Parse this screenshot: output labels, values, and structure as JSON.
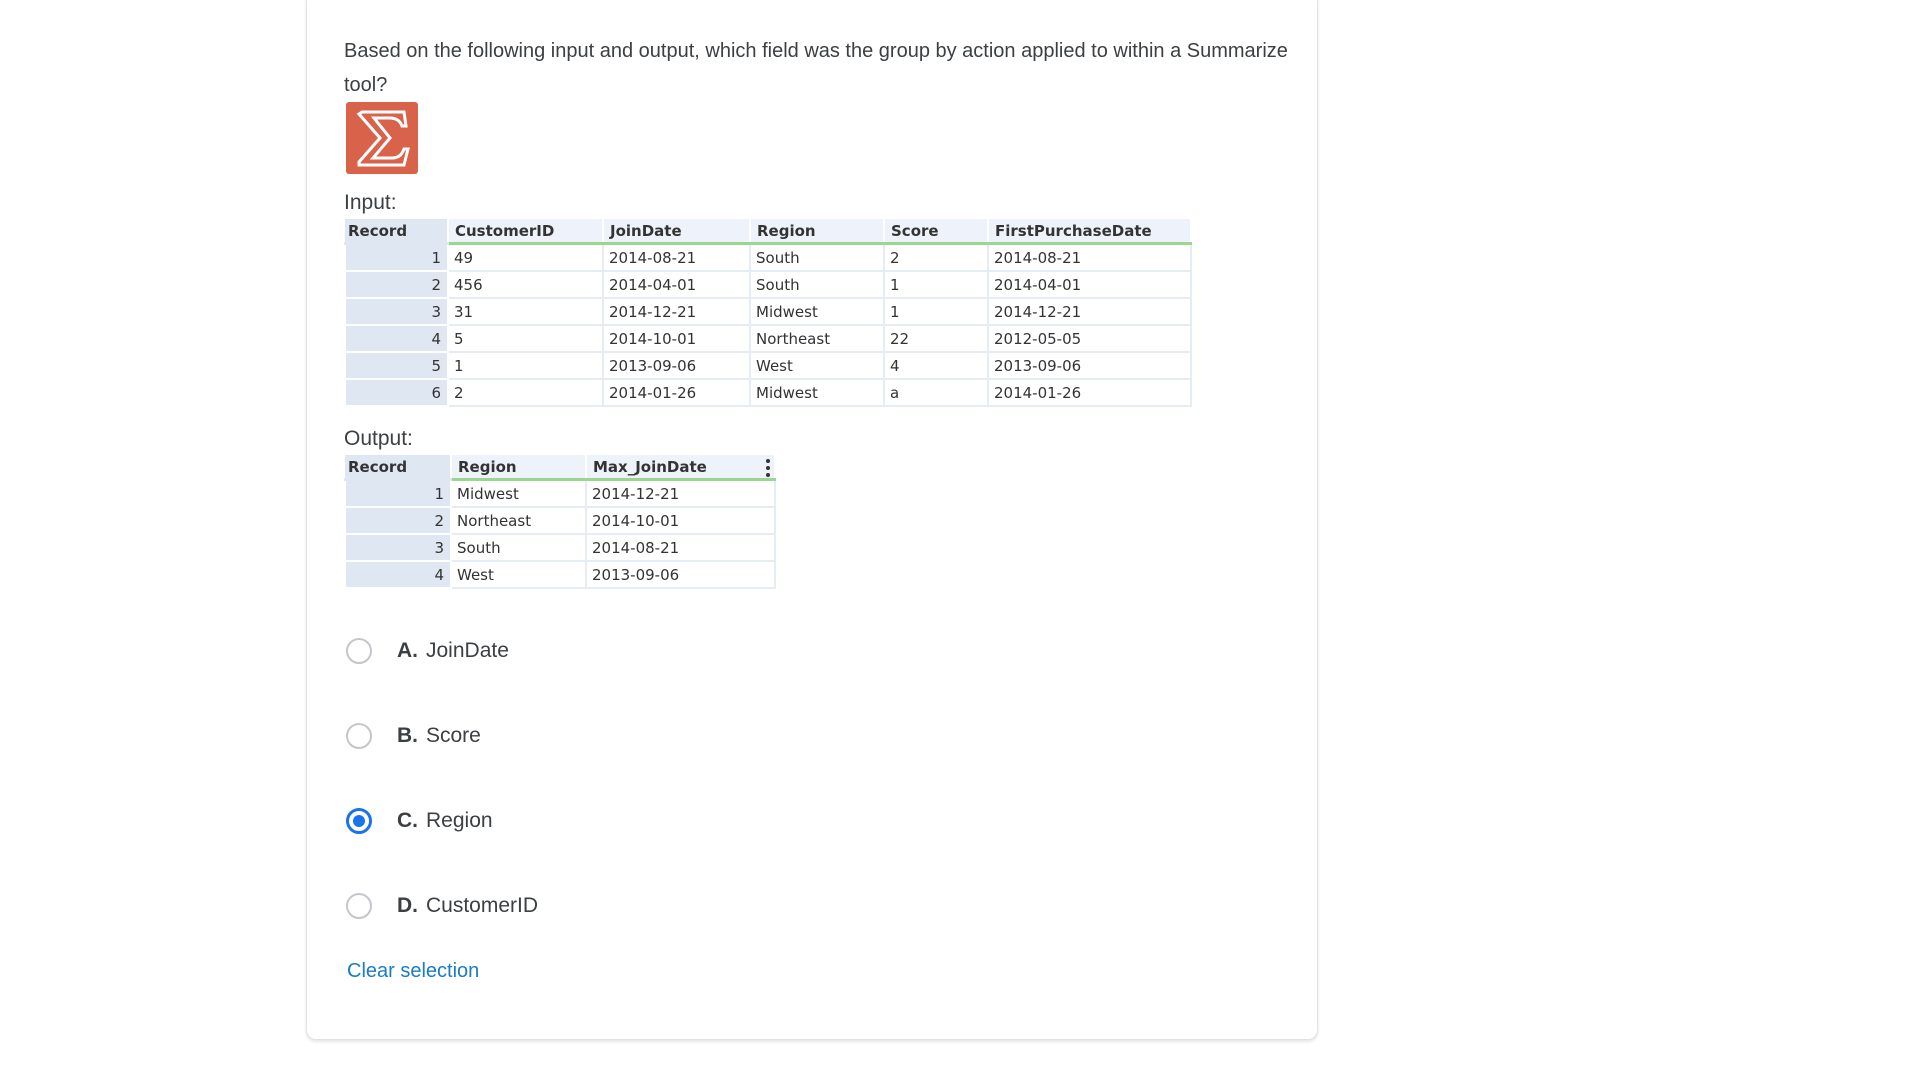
{
  "question": {
    "text": "Based on the following input and output, which field was the group by action applied to within a Summarize tool?",
    "icon": "summarize-sigma-icon",
    "icon_color": "#d9634a"
  },
  "input": {
    "label": "Input:",
    "columns": [
      "Record",
      "CustomerID",
      "JoinDate",
      "Region",
      "Score",
      "FirstPurchaseDate"
    ],
    "rows": [
      [
        "1",
        "49",
        "2014-08-21",
        "South",
        "2",
        "2014-08-21"
      ],
      [
        "2",
        "456",
        "2014-04-01",
        "South",
        "1",
        "2014-04-01"
      ],
      [
        "3",
        "31",
        "2014-12-21",
        "Midwest",
        "1",
        "2014-12-21"
      ],
      [
        "4",
        "5",
        "2014-10-01",
        "Northeast",
        "22",
        "2012-05-05"
      ],
      [
        "5",
        "1",
        "2013-09-06",
        "West",
        "4",
        "2013-09-06"
      ],
      [
        "6",
        "2",
        "2014-01-26",
        "Midwest",
        "a",
        "2014-01-26"
      ]
    ]
  },
  "output": {
    "label": "Output:",
    "columns": [
      "Record",
      "Region",
      "Max_JoinDate"
    ],
    "rows": [
      [
        "1",
        "Midwest",
        "2014-12-21"
      ],
      [
        "2",
        "Northeast",
        "2014-10-01"
      ],
      [
        "3",
        "South",
        "2014-08-21"
      ],
      [
        "4",
        "West",
        "2013-09-06"
      ]
    ]
  },
  "options": [
    {
      "letter": "A.",
      "text": "JoinDate",
      "selected": false
    },
    {
      "letter": "B.",
      "text": "Score",
      "selected": false
    },
    {
      "letter": "C.",
      "text": "Region",
      "selected": true
    },
    {
      "letter": "D.",
      "text": "CustomerID",
      "selected": false
    }
  ],
  "clear_selection": "Clear selection",
  "colors": {
    "accent": "#1a73e8",
    "link": "#1a7cc4",
    "header_underline": "#99d68f"
  }
}
